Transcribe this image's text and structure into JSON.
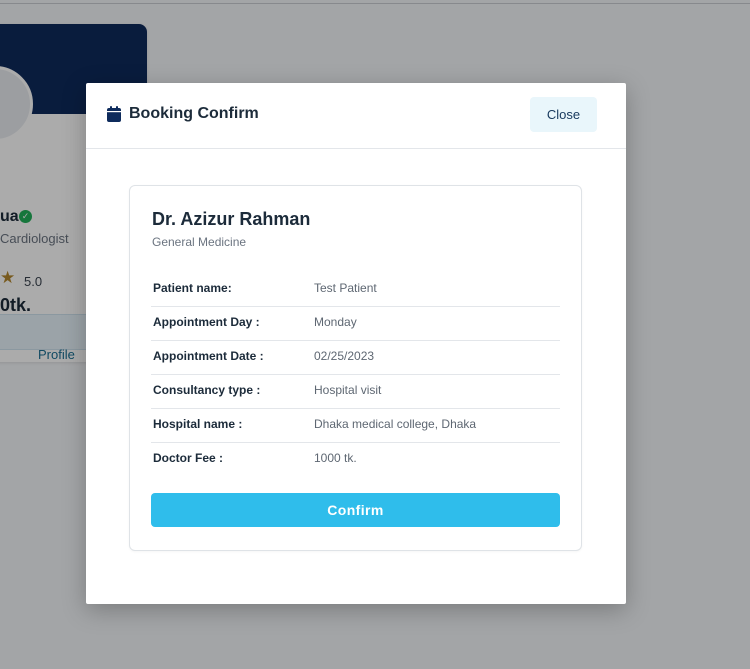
{
  "background": {
    "doctor_name_fragment": "ua",
    "specialty_fragment": "Cardiologist",
    "rating": "5.0",
    "fee_fragment": "0tk.",
    "profile_label": "Profile"
  },
  "modal": {
    "title": "Booking Confirm",
    "close_label": "Close",
    "doctor": {
      "name": "Dr. Azizur Rahman",
      "specialty": "General Medicine"
    },
    "details": [
      {
        "label": "Patient name:",
        "value": "Test Patient"
      },
      {
        "label": "Appointment Day :",
        "value": "Monday"
      },
      {
        "label": "Appointment Date :",
        "value": "02/25/2023"
      },
      {
        "label": "Consultancy type :",
        "value": "Hospital visit"
      },
      {
        "label": "Hospital name :",
        "value": "Dhaka medical college, Dhaka"
      },
      {
        "label": "Doctor Fee :",
        "value": "1000 tk."
      }
    ],
    "confirm_label": "Confirm"
  },
  "colors": {
    "accent": "#2fbdeb",
    "banner": "#0e2b5c",
    "verified": "#22b05a",
    "star": "#b3862d"
  },
  "icons": [
    "calendar-icon",
    "verified-icon",
    "star-icon"
  ]
}
